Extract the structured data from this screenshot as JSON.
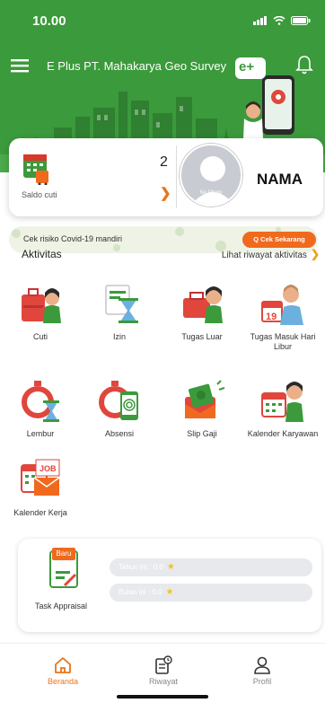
{
  "status_bar": {
    "time": "10.00"
  },
  "header": {
    "company_name": "E Plus PT. Mahakarya Geo Survey",
    "logo_text": "e+"
  },
  "summary": {
    "leave_count": "2",
    "leave_label": "Saldo cuti",
    "avatar_label": "No Photo",
    "user_name": "NAMA"
  },
  "covid": {
    "text": "Cek risiko Covid-19 mandiri",
    "button_label": "Q  Cek Sekarang"
  },
  "activities": {
    "title": "Aktivitas",
    "history_link": "Lihat riwayat aktivitas",
    "items": [
      {
        "label": "Cuti",
        "icon": "suitcase-icon"
      },
      {
        "label": "Izin",
        "icon": "hourglass-icon"
      },
      {
        "label": "Tugas Luar",
        "icon": "briefcase-icon"
      },
      {
        "label": "Tugas Masuk Hari Libur",
        "icon": "calendar-worker-icon"
      },
      {
        "label": "Lembur",
        "icon": "overtime-clock-icon"
      },
      {
        "label": "Absensi",
        "icon": "fingerprint-icon"
      },
      {
        "label": "Slip Gaji",
        "icon": "payslip-icon"
      },
      {
        "label": "Kalender Karyawan",
        "icon": "employee-calendar-icon"
      },
      {
        "label": "Kalender Kerja",
        "icon": "job-calendar-icon"
      }
    ]
  },
  "appraisal": {
    "badge": "Baru",
    "label": "Task Appraisal",
    "this_year": "Tahun ini : 0.0",
    "this_month": "Bulan ini : 0.0"
  },
  "nav": {
    "items": [
      {
        "label": "Beranda"
      },
      {
        "label": "Riwayat"
      },
      {
        "label": "Profil"
      }
    ]
  },
  "colors": {
    "primary_green": "#3b9a3b",
    "accent_orange": "#f06a1e"
  }
}
